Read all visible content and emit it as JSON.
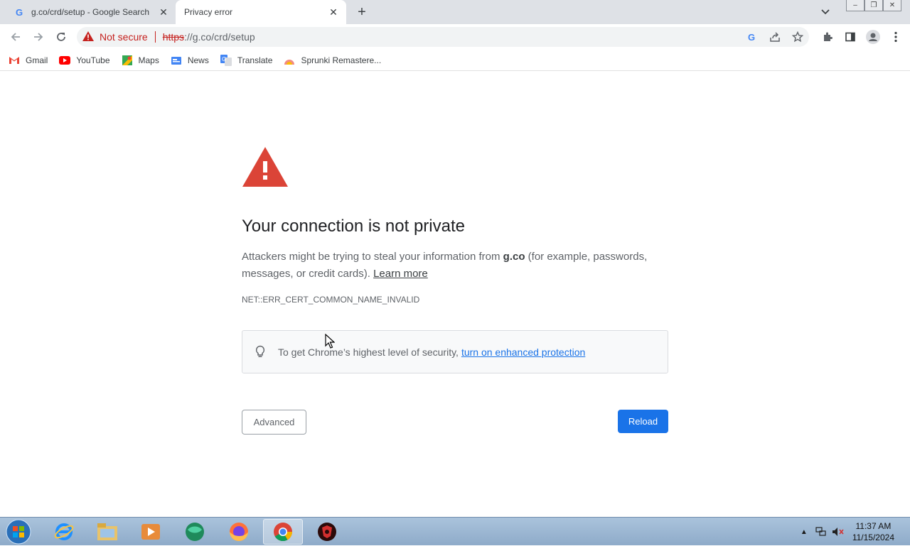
{
  "tabs": [
    {
      "title": "g.co/crd/setup - Google Search",
      "icon": "google-g-icon",
      "active": false
    },
    {
      "title": "Privacy error",
      "icon": "none",
      "active": true
    }
  ],
  "toolbar": {
    "security_label": "Not secure",
    "url_scheme": "https",
    "url_rest": "://g.co/crd/setup"
  },
  "bookmarks": [
    {
      "label": "Gmail",
      "icon": "gmail-icon"
    },
    {
      "label": "YouTube",
      "icon": "youtube-icon"
    },
    {
      "label": "Maps",
      "icon": "maps-icon"
    },
    {
      "label": "News",
      "icon": "news-icon"
    },
    {
      "label": "Translate",
      "icon": "translate-icon"
    },
    {
      "label": "Sprunki Remastere...",
      "icon": "sprunki-icon"
    }
  ],
  "page": {
    "heading": "Your connection is not private",
    "para_before": "Attackers might be trying to steal your information from ",
    "para_domain": "g.co",
    "para_after": " (for example, passwords, messages, or credit cards). ",
    "learn_more": "Learn more",
    "error_code": "NET::ERR_CERT_COMMON_NAME_INVALID",
    "enhanced_text": "To get Chrome’s highest level of security, ",
    "enhanced_link": "turn on enhanced protection",
    "advanced_button": "Advanced",
    "reload_button": "Reload"
  },
  "taskbar": {
    "apps": [
      "internet-explorer-icon",
      "file-explorer-icon",
      "media-player-icon",
      "globe-app-icon",
      "firefox-icon",
      "chrome-icon",
      "game-app-icon"
    ],
    "time": "11:37 AM",
    "date": "11/15/2024"
  },
  "colors": {
    "error_red": "#c5221f",
    "accent_blue": "#1a73e8",
    "warning_triangle": "#db4437"
  }
}
